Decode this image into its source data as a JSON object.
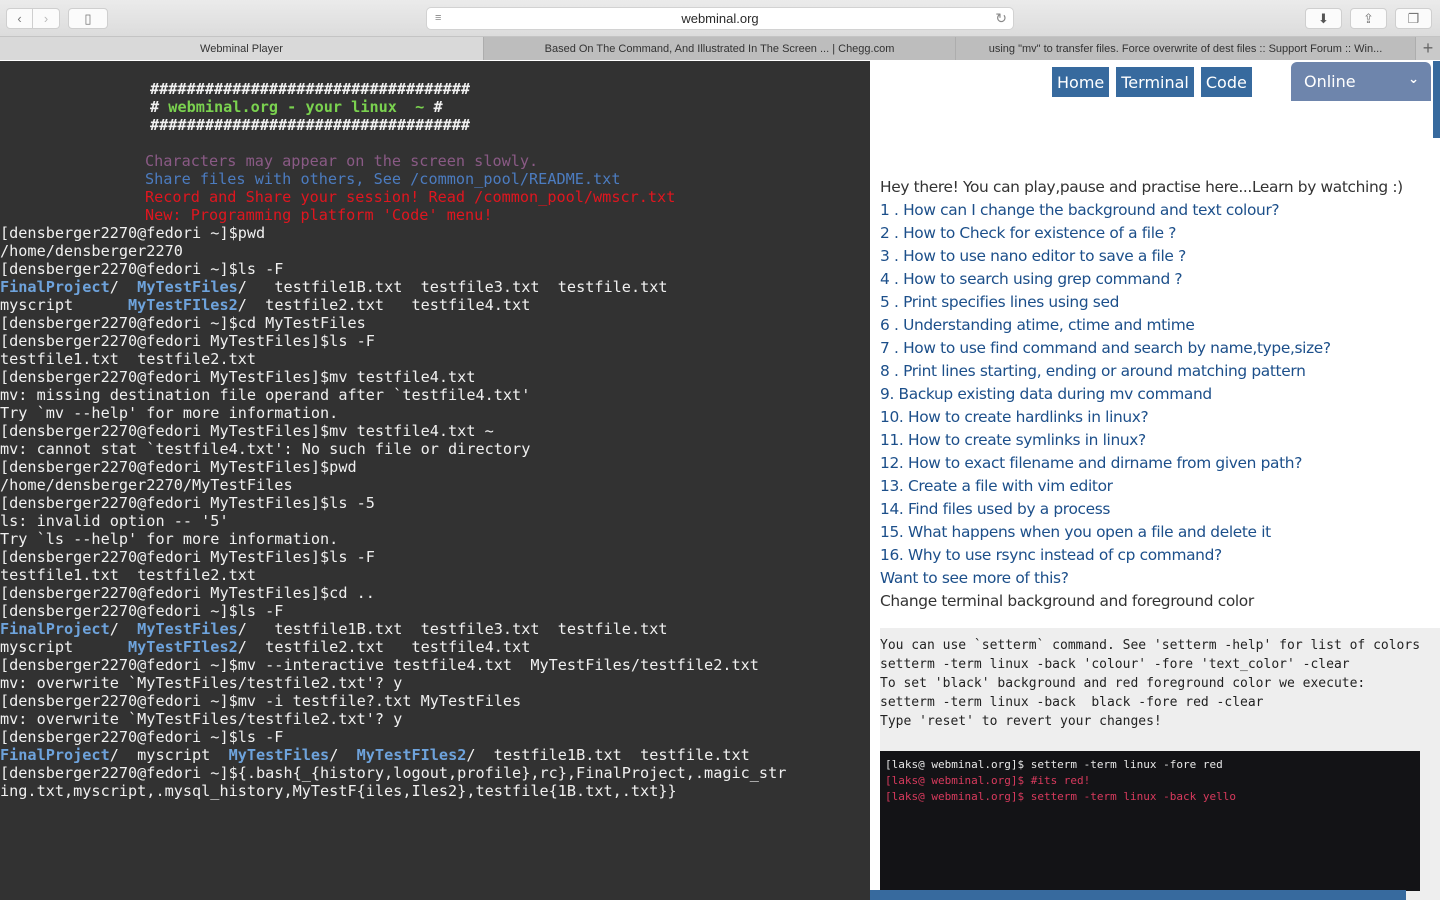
{
  "browser": {
    "url": "webminal.org",
    "tabs": [
      {
        "title": "Webminal Player",
        "active": true
      },
      {
        "title": "Based On The Command, And Illustrated In The Screen ... | Chegg.com",
        "active": false
      },
      {
        "title": "using \"mv\" to transfer files. Force overwrite of dest files :: Support Forum :: Win...",
        "active": false
      }
    ],
    "new_tab_label": "+",
    "icons": {
      "back": "‹",
      "forward": "›",
      "sidebar": "▯",
      "reader": "≡",
      "reload": "↻",
      "download": "⬇",
      "share": "⇪",
      "tabs_overview": "❐"
    }
  },
  "terminal": {
    "banner": {
      "border": "###################################",
      "title_prefix": "# ",
      "title": "webminal.org - your linux  ~",
      "title_suffix": " #"
    },
    "motd": {
      "slow": "Characters may appear on the screen slowly.",
      "share": "Share files with others, See /common_pool/README.txt",
      "record": "Record and Share your session! Read /common_pool/wmscr.txt",
      "new": "New: Programming platform 'Code' menu!"
    },
    "lines": [
      {
        "segments": [
          {
            "t": "[densberger2270@fedori ~]$pwd"
          }
        ]
      },
      {
        "segments": [
          {
            "t": "/home/densberger2270"
          }
        ]
      },
      {
        "segments": [
          {
            "t": "[densberger2270@fedori ~]$ls -F"
          }
        ]
      },
      {
        "segments": [
          {
            "t": "FinalProject",
            "c": "dir"
          },
          {
            "t": "/  "
          },
          {
            "t": "MyTestFiles",
            "c": "dir"
          },
          {
            "t": "/   testfile1B.txt  testfile3.txt  testfile.txt"
          }
        ]
      },
      {
        "segments": [
          {
            "t": "myscript      "
          },
          {
            "t": "MyTestFIles2",
            "c": "dir"
          },
          {
            "t": "/  testfile2.txt   testfile4.txt"
          }
        ]
      },
      {
        "segments": [
          {
            "t": "[densberger2270@fedori ~]$cd MyTestFiles"
          }
        ]
      },
      {
        "segments": [
          {
            "t": "[densberger2270@fedori MyTestFiles]$ls -F"
          }
        ]
      },
      {
        "segments": [
          {
            "t": "testfile1.txt  testfile2.txt"
          }
        ]
      },
      {
        "segments": [
          {
            "t": "[densberger2270@fedori MyTestFiles]$mv testfile4.txt"
          }
        ]
      },
      {
        "segments": [
          {
            "t": "mv: missing destination file operand after `testfile4.txt'"
          }
        ]
      },
      {
        "segments": [
          {
            "t": "Try `mv --help' for more information."
          }
        ]
      },
      {
        "segments": [
          {
            "t": "[densberger2270@fedori MyTestFiles]$mv testfile4.txt ~"
          }
        ]
      },
      {
        "segments": [
          {
            "t": "mv: cannot stat `testfile4.txt': No such file or directory"
          }
        ]
      },
      {
        "segments": [
          {
            "t": "[densberger2270@fedori MyTestFiles]$pwd"
          }
        ]
      },
      {
        "segments": [
          {
            "t": "/home/densberger2270/MyTestFiles"
          }
        ]
      },
      {
        "segments": [
          {
            "t": "[densberger2270@fedori MyTestFiles]$ls -5"
          }
        ]
      },
      {
        "segments": [
          {
            "t": "ls: invalid option -- '5'"
          }
        ]
      },
      {
        "segments": [
          {
            "t": "Try `ls --help' for more information."
          }
        ]
      },
      {
        "segments": [
          {
            "t": "[densberger2270@fedori MyTestFiles]$ls -F"
          }
        ]
      },
      {
        "segments": [
          {
            "t": "testfile1.txt  testfile2.txt"
          }
        ]
      },
      {
        "segments": [
          {
            "t": "[densberger2270@fedori MyTestFiles]$cd .."
          }
        ]
      },
      {
        "segments": [
          {
            "t": "[densberger2270@fedori ~]$ls -F"
          }
        ]
      },
      {
        "segments": [
          {
            "t": "FinalProject",
            "c": "dir"
          },
          {
            "t": "/  "
          },
          {
            "t": "MyTestFiles",
            "c": "dir"
          },
          {
            "t": "/   testfile1B.txt  testfile3.txt  testfile.txt"
          }
        ]
      },
      {
        "segments": [
          {
            "t": "myscript      "
          },
          {
            "t": "MyTestFIles2",
            "c": "dir"
          },
          {
            "t": "/  testfile2.txt   testfile4.txt"
          }
        ]
      },
      {
        "segments": [
          {
            "t": "[densberger2270@fedori ~]$mv --interactive testfile4.txt  MyTestFiles/testfile2.txt"
          }
        ]
      },
      {
        "segments": [
          {
            "t": "mv: overwrite `MyTestFiles/testfile2.txt'? y"
          }
        ]
      },
      {
        "segments": [
          {
            "t": "[densberger2270@fedori ~]$mv -i testfile?.txt MyTestFiles"
          }
        ]
      },
      {
        "segments": [
          {
            "t": "mv: overwrite `MyTestFiles/testfile2.txt'? y"
          }
        ]
      },
      {
        "segments": [
          {
            "t": "[densberger2270@fedori ~]$ls -F"
          }
        ]
      },
      {
        "segments": [
          {
            "t": "FinalProject",
            "c": "dir"
          },
          {
            "t": "/  myscript  "
          },
          {
            "t": "MyTestFiles",
            "c": "dir"
          },
          {
            "t": "/  "
          },
          {
            "t": "MyTestFIles2",
            "c": "dir"
          },
          {
            "t": "/  testfile1B.txt  testfile.txt"
          }
        ]
      },
      {
        "segments": [
          {
            "t": "[densberger2270@fedori ~]${.bash{_{history,logout,profile},rc},FinalProject,.magic_str"
          }
        ]
      },
      {
        "segments": [
          {
            "t": "ing.txt,myscript,.mysql_history,MyTestF{iles,Iles2},testfile{1B.txt,.txt}}"
          }
        ]
      }
    ]
  },
  "side": {
    "nav": {
      "home": "Home",
      "terminal": "Terminal",
      "code": "Code"
    },
    "status_select": {
      "value": "Online",
      "chevron": "⌄"
    },
    "intro": "Hey there! You can play,pause and practise here...Learn by watching :)",
    "lessons": [
      "1 . How can I change the background and text colour?",
      "2 . How to Check for existence of a file ?",
      "3 . How to use nano editor to save a file ?",
      "4 . How to search using grep command ?",
      "5 . Print specifies lines using sed",
      "6 . Understanding atime, ctime and mtime",
      "7 . How to use find command and search by name,type,size?",
      "8 . Print lines starting, ending or around matching pattern",
      "9. Backup existing data during mv command",
      "10. How to create hardlinks in linux?",
      "11. How to create symlinks in linux?",
      "12. How to exact filename and dirname from given path?",
      "13. Create a file with vim editor",
      "14. Find files used by a process",
      "15. What happens when you open a file and delete it",
      "16. Why to use rsync instead of cp command?"
    ],
    "more_link": "Want to see more of this?",
    "section_title": "Change terminal background and foreground color",
    "code_lines": [
      "You can use `setterm` command. See 'setterm -help' for list of colors",
      "setterm -term linux -back 'colour' -fore 'text_color' -clear",
      "To set 'black' background and red foreground color we execute:",
      "setterm -term linux -back  black -fore red -clear",
      "Type 'reset' to revert your changes!"
    ],
    "demo_terminal": [
      {
        "text": "[laks@ webminal.org]$ setterm -term linux -fore red",
        "color": "white"
      },
      {
        "text": "[laks@ webminal.org]$ #its red!",
        "color": "pink"
      },
      {
        "text": "[laks@ webminal.org]$ setterm -term linux -back yello",
        "color": "pink"
      }
    ]
  },
  "colors": {
    "terminal_bg": "#323232",
    "directory": "#6ea3dc",
    "banner_green": "#7ad24f",
    "motd_purple": "#8a5a85",
    "motd_blue": "#4c7cc0",
    "motd_red": "#e0161f",
    "nav_blue": "#376a9e",
    "status_select_bg": "#6e85ac",
    "link": "#1c4f8a",
    "demo_pink": "#d83a5d"
  }
}
